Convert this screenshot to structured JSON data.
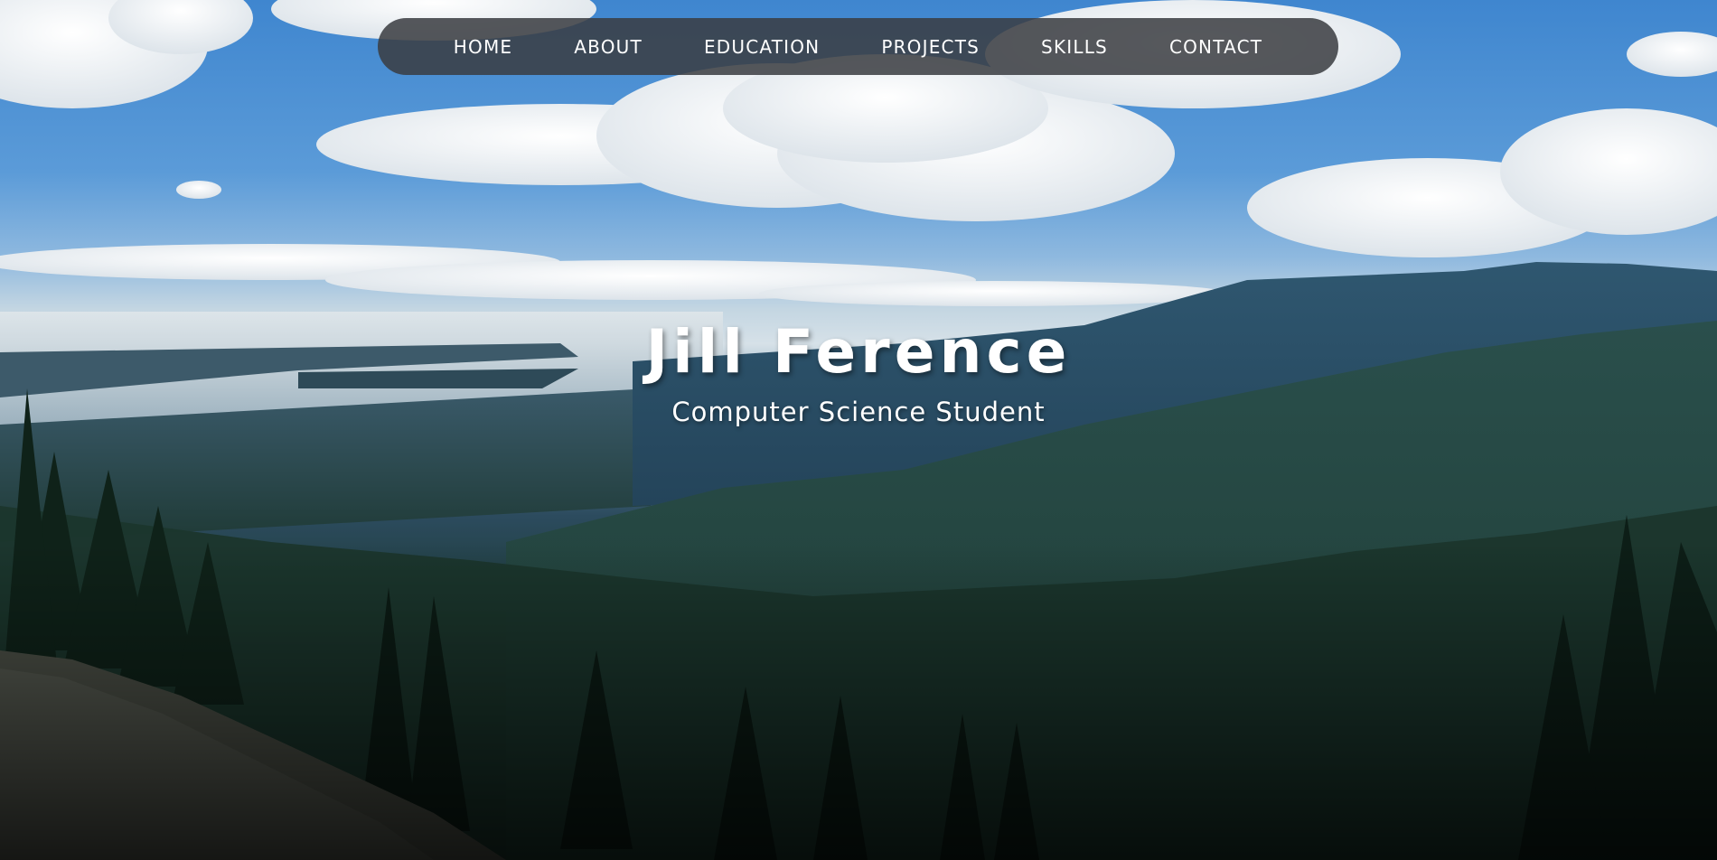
{
  "nav": {
    "items": [
      {
        "label": "HOME"
      },
      {
        "label": "ABOUT"
      },
      {
        "label": "EDUCATION"
      },
      {
        "label": "PROJECTS"
      },
      {
        "label": "SKILLS"
      },
      {
        "label": "CONTACT"
      }
    ]
  },
  "hero": {
    "name": "Jill Ference",
    "subtitle": "Computer Science Student"
  },
  "colors": {
    "nav_background": "#3a3c41",
    "text": "#ffffff",
    "sky": "#4a8fd4",
    "forest": "#1f3d33"
  }
}
